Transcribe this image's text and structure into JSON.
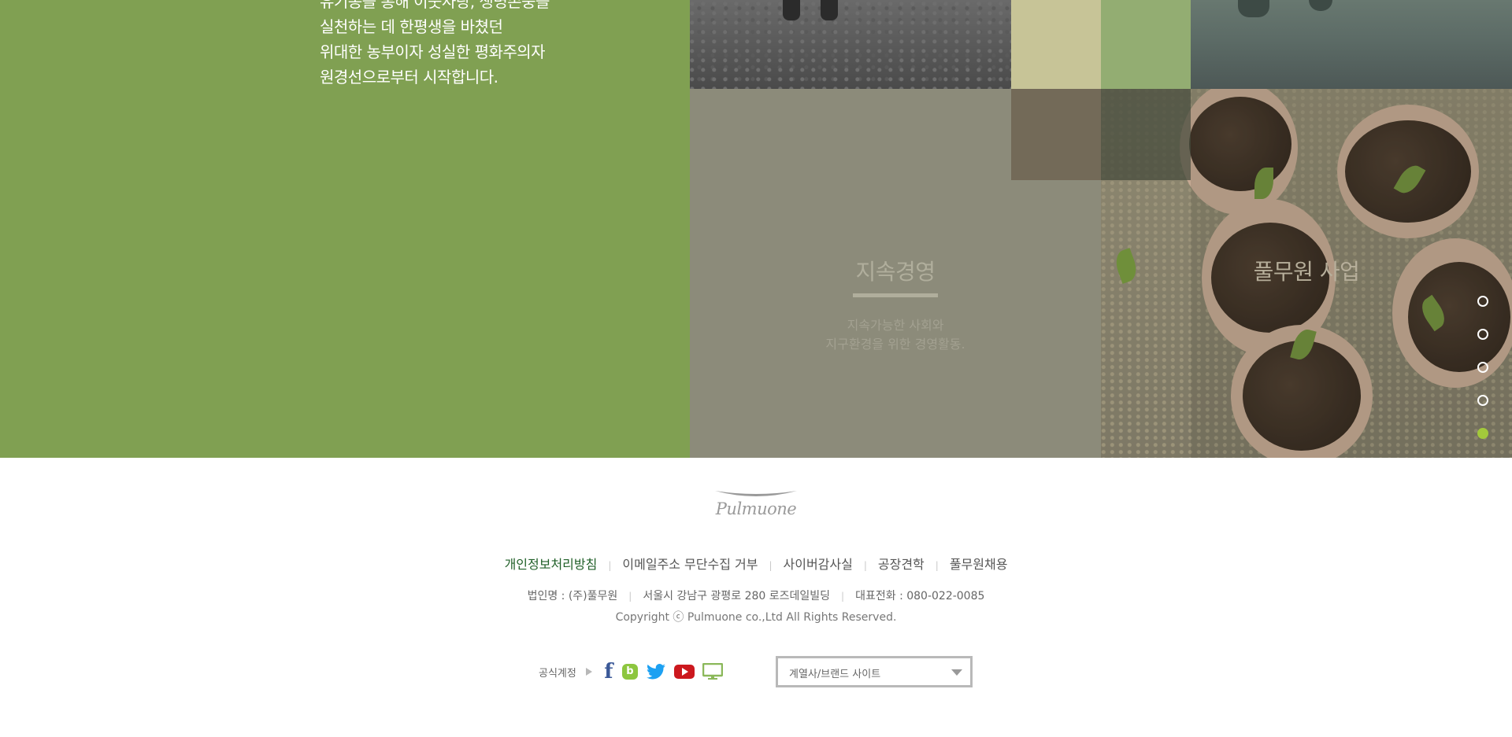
{
  "intro": {
    "lines": [
      "유기농을 통해 이웃사랑, 생명존중을",
      "실천하는 데 한평생을 바쳤던",
      "위대한 농부이자 성실한 평화주의자",
      "원경선으로부터 시작합니다."
    ]
  },
  "panels": {
    "sustainability": {
      "title": "지속경영",
      "desc_line1": "지속가능한 사회와",
      "desc_line2": "지구환경을 위한 경영활동."
    },
    "business": {
      "title": "풀무원 사업"
    }
  },
  "pager": {
    "count": 5,
    "active_index": 4
  },
  "footer": {
    "logo_text": "Pulmuone",
    "links": [
      "개인정보처리방침",
      "이메일주소 무단수집 거부",
      "사이버감사실",
      "공장견학",
      "풀무원채용"
    ],
    "corp_name": "법인명 : (주)풀무원",
    "address": "서울시 강남구 광평로 280 로즈데일빌딩",
    "phone": "대표전화 : 080-022-0085",
    "copyright": "Copyright ⓒ Pulmuone co.,Ltd All Rights Reserved.",
    "official_label": "공식계정",
    "sns": [
      {
        "name": "facebook-icon",
        "color": "#3b5998"
      },
      {
        "name": "blog-icon",
        "color": "#8dc63f"
      },
      {
        "name": "twitter-icon",
        "color": "#1da1f2"
      },
      {
        "name": "youtube-icon",
        "color": "#cc181e"
      },
      {
        "name": "pc-site-icon",
        "color": "#8bb85a"
      }
    ],
    "family_select_label": "계열사/브랜드 사이트"
  },
  "colors": {
    "green_panel": "#80a052",
    "link_active": "#1f5f27",
    "pager_active": "#a3c93b"
  }
}
